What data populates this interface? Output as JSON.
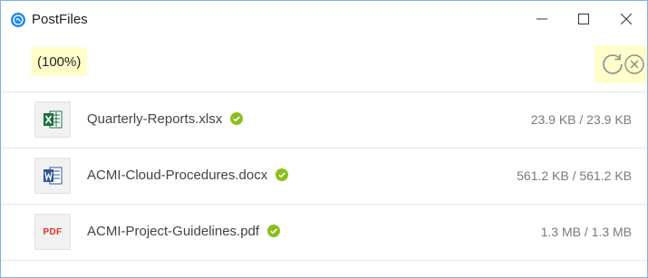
{
  "window": {
    "title": "PostFiles",
    "accent_color": "#1e88e5",
    "border_color": "#7fb2e5"
  },
  "toolbar": {
    "progress": "(100%)",
    "progress_highlight": "#ffffcc",
    "actions": [
      "refresh-icon",
      "cancel-icon"
    ]
  },
  "files": [
    {
      "name": "Quarterly-Reports.xlsx",
      "type_icon": "excel-file-icon",
      "status": "complete",
      "size": "23.9 KB / 23.9 KB"
    },
    {
      "name": "ACMI-Cloud-Procedures.docx",
      "type_icon": "word-file-icon",
      "status": "complete",
      "size": "561.2 KB / 561.2 KB"
    },
    {
      "name": "ACMI-Project-Guidelines.pdf",
      "type_icon": "pdf-file-icon",
      "pdf_label": "PDF",
      "status": "complete",
      "size": "1.3 MB / 1.3 MB"
    }
  ],
  "colors": {
    "check_green": "#8cbd1d",
    "excel_green": "#1e7145",
    "word_blue": "#2b579a",
    "pdf_red": "#d9342b"
  }
}
